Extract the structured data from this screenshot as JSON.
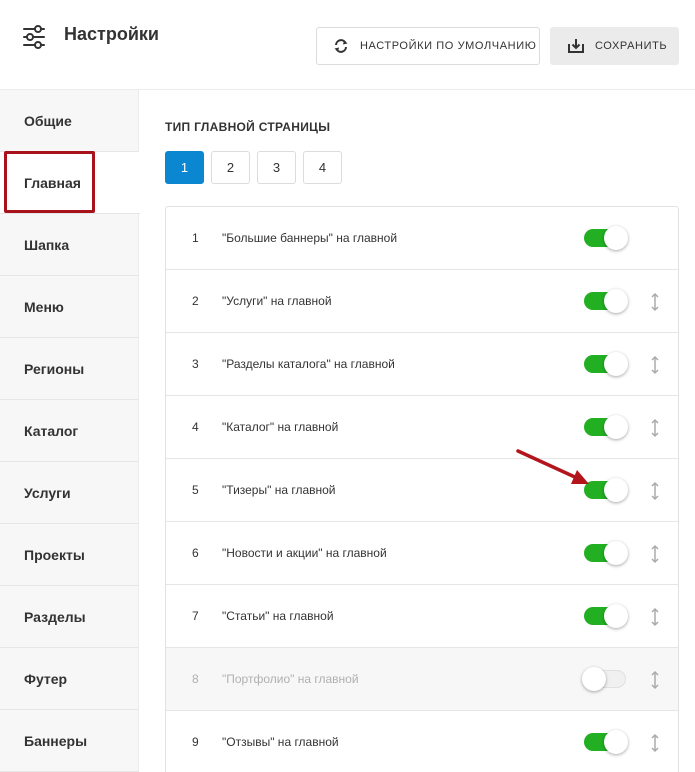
{
  "header": {
    "title": "Настройки",
    "settings_icon": "sliders-icon",
    "defaults_button": {
      "label": "НАСТРОЙКИ ПО УМОЛЧАНИЮ",
      "icon": "refresh-icon"
    },
    "save_button": {
      "label": "СОХРАНИТЬ",
      "icon": "download-icon"
    }
  },
  "sidebar": {
    "items": [
      {
        "label": "Общие",
        "active": false
      },
      {
        "label": "Главная",
        "active": true
      },
      {
        "label": "Шапка",
        "active": false
      },
      {
        "label": "Меню",
        "active": false
      },
      {
        "label": "Регионы",
        "active": false
      },
      {
        "label": "Каталог",
        "active": false
      },
      {
        "label": "Услуги",
        "active": false
      },
      {
        "label": "Проекты",
        "active": false
      },
      {
        "label": "Разделы",
        "active": false
      },
      {
        "label": "Футер",
        "active": false
      },
      {
        "label": "Баннеры",
        "active": false
      }
    ]
  },
  "main": {
    "section_title": "ТИП ГЛАВНОЙ СТРАНИЦЫ",
    "page_types": [
      "1",
      "2",
      "3",
      "4"
    ],
    "selected_page_type": "1",
    "blocks": [
      {
        "num": "1",
        "label": "\"Большие баннеры\" на главной",
        "enabled": true,
        "draggable": false
      },
      {
        "num": "2",
        "label": "\"Услуги\" на главной",
        "enabled": true,
        "draggable": true
      },
      {
        "num": "3",
        "label": "\"Разделы каталога\" на главной",
        "enabled": true,
        "draggable": true
      },
      {
        "num": "4",
        "label": "\"Каталог\" на главной",
        "enabled": true,
        "draggable": true
      },
      {
        "num": "5",
        "label": "\"Тизеры\" на главной",
        "enabled": true,
        "draggable": true
      },
      {
        "num": "6",
        "label": "\"Новости и акции\" на главной",
        "enabled": true,
        "draggable": true
      },
      {
        "num": "7",
        "label": "\"Статьи\" на главной",
        "enabled": true,
        "draggable": true
      },
      {
        "num": "8",
        "label": "\"Портфолио\" на главной",
        "enabled": false,
        "draggable": true
      },
      {
        "num": "9",
        "label": "\"Отзывы\" на главной",
        "enabled": true,
        "draggable": true
      }
    ]
  },
  "colors": {
    "accent": "#0a87d0",
    "toggle_on": "#22b022",
    "highlight": "#a8121a"
  }
}
